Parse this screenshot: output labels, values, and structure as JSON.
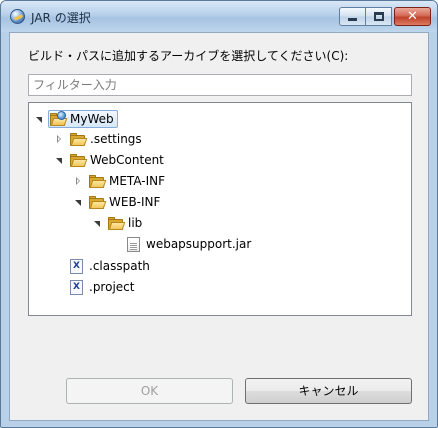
{
  "window": {
    "title": "JAR の選択",
    "controls": {
      "minimize": "minimize",
      "maximize": "maximize",
      "close": "✕"
    }
  },
  "dialog": {
    "prompt": "ビルド・パスに追加するアーカイブを選択してください(C):",
    "filter_placeholder": "フィルター入力",
    "filter_value": ""
  },
  "tree": {
    "nodes": [
      {
        "label": "MyWeb",
        "icon": "project-folder-icon",
        "state": "open",
        "selected": true
      },
      {
        "label": ".settings",
        "icon": "folder-icon",
        "state": "closed"
      },
      {
        "label": "WebContent",
        "icon": "folder-icon",
        "state": "open"
      },
      {
        "label": "META-INF",
        "icon": "folder-icon",
        "state": "closed"
      },
      {
        "label": "WEB-INF",
        "icon": "folder-icon",
        "state": "open"
      },
      {
        "label": "lib",
        "icon": "folder-icon",
        "state": "open"
      },
      {
        "label": "webapsupport.jar",
        "icon": "jar-file-icon",
        "state": "none"
      },
      {
        "label": ".classpath",
        "icon": "xml-file-icon",
        "state": "none"
      },
      {
        "label": ".project",
        "icon": "xml-file-icon",
        "state": "none"
      }
    ]
  },
  "buttons": {
    "ok": "OK",
    "cancel": "キャンセル"
  },
  "colors": {
    "accent": "#84acdd",
    "folder": "#f2c75a",
    "close_button": "#c0412c"
  }
}
